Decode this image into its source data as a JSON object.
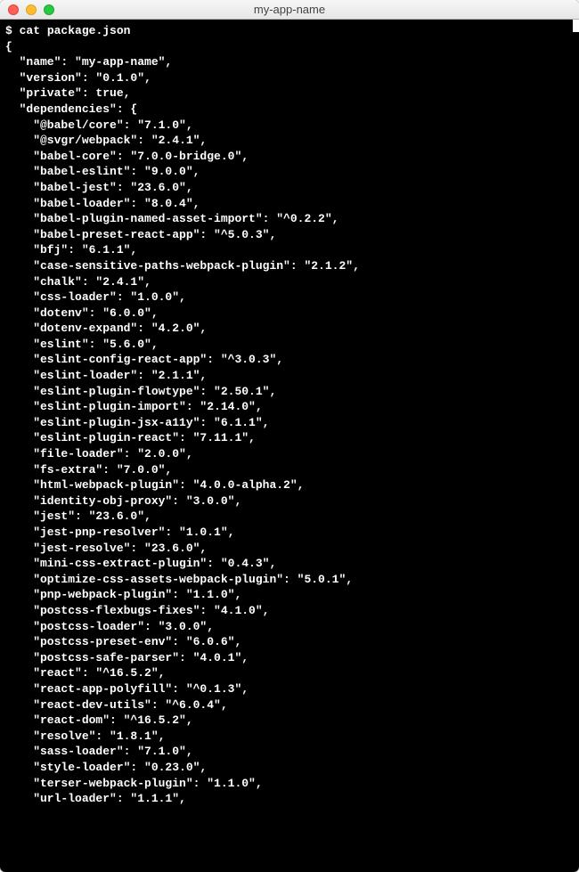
{
  "window": {
    "title": "my-app-name"
  },
  "prompt": "$",
  "command": "cat package.json",
  "json": {
    "open": "{",
    "name_line": "  \"name\": \"my-app-name\",",
    "version_line": "  \"version\": \"0.1.0\",",
    "private_line": "  \"private\": true,",
    "deps_open": "  \"dependencies\": {",
    "deps": [
      "    \"@babel/core\": \"7.1.0\",",
      "    \"@svgr/webpack\": \"2.4.1\",",
      "    \"babel-core\": \"7.0.0-bridge.0\",",
      "    \"babel-eslint\": \"9.0.0\",",
      "    \"babel-jest\": \"23.6.0\",",
      "    \"babel-loader\": \"8.0.4\",",
      "    \"babel-plugin-named-asset-import\": \"^0.2.2\",",
      "    \"babel-preset-react-app\": \"^5.0.3\",",
      "    \"bfj\": \"6.1.1\",",
      "    \"case-sensitive-paths-webpack-plugin\": \"2.1.2\",",
      "    \"chalk\": \"2.4.1\",",
      "    \"css-loader\": \"1.0.0\",",
      "    \"dotenv\": \"6.0.0\",",
      "    \"dotenv-expand\": \"4.2.0\",",
      "    \"eslint\": \"5.6.0\",",
      "    \"eslint-config-react-app\": \"^3.0.3\",",
      "    \"eslint-loader\": \"2.1.1\",",
      "    \"eslint-plugin-flowtype\": \"2.50.1\",",
      "    \"eslint-plugin-import\": \"2.14.0\",",
      "    \"eslint-plugin-jsx-a11y\": \"6.1.1\",",
      "    \"eslint-plugin-react\": \"7.11.1\",",
      "    \"file-loader\": \"2.0.0\",",
      "    \"fs-extra\": \"7.0.0\",",
      "    \"html-webpack-plugin\": \"4.0.0-alpha.2\",",
      "    \"identity-obj-proxy\": \"3.0.0\",",
      "    \"jest\": \"23.6.0\",",
      "    \"jest-pnp-resolver\": \"1.0.1\",",
      "    \"jest-resolve\": \"23.6.0\",",
      "    \"mini-css-extract-plugin\": \"0.4.3\",",
      "    \"optimize-css-assets-webpack-plugin\": \"5.0.1\",",
      "    \"pnp-webpack-plugin\": \"1.1.0\",",
      "    \"postcss-flexbugs-fixes\": \"4.1.0\",",
      "    \"postcss-loader\": \"3.0.0\",",
      "    \"postcss-preset-env\": \"6.0.6\",",
      "    \"postcss-safe-parser\": \"4.0.1\",",
      "    \"react\": \"^16.5.2\",",
      "    \"react-app-polyfill\": \"^0.1.3\",",
      "    \"react-dev-utils\": \"^6.0.4\",",
      "    \"react-dom\": \"^16.5.2\",",
      "    \"resolve\": \"1.8.1\",",
      "    \"sass-loader\": \"7.1.0\",",
      "    \"style-loader\": \"0.23.0\",",
      "    \"terser-webpack-plugin\": \"1.1.0\",",
      "    \"url-loader\": \"1.1.1\","
    ]
  }
}
